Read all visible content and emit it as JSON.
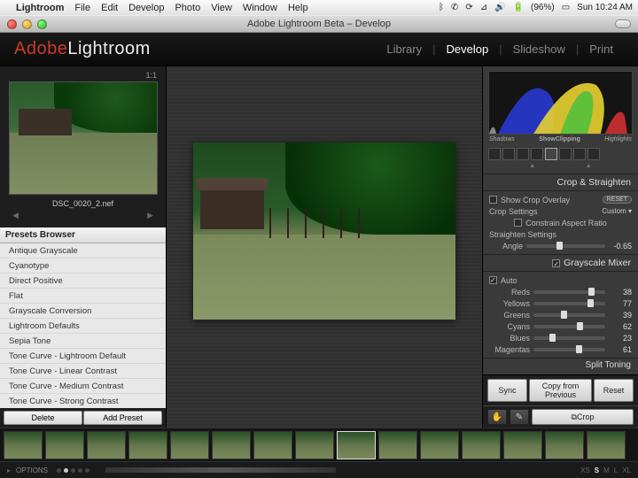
{
  "menubar": {
    "app": "Lightroom",
    "items": [
      "File",
      "Edit",
      "Develop",
      "Photo",
      "View",
      "Window",
      "Help"
    ],
    "battery": "(96%)",
    "clock": "Sun 10:24 AM"
  },
  "window_title": "Adobe Lightroom Beta – Develop",
  "logo": {
    "adobe": "Adobe",
    "product": "Lightroom"
  },
  "modules": {
    "items": [
      "Library",
      "Develop",
      "Slideshow",
      "Print"
    ],
    "active": "Develop"
  },
  "navigator": {
    "ratio": "1:1",
    "filename": "DSC_0020_2.nef"
  },
  "presets": {
    "header": "Presets Browser",
    "items": [
      "Antique Grayscale",
      "Cyanotype",
      "Direct Positive",
      "Flat",
      "Grayscale Conversion",
      "Lightroom Defaults",
      "Sepia Tone",
      "Tone Curve - Lightroom Default",
      "Tone Curve - Linear Contrast",
      "Tone Curve - Medium Contrast",
      "Tone Curve - Strong Contrast"
    ],
    "delete": "Delete",
    "add": "Add Preset"
  },
  "histogram": {
    "shadows": "Shadows",
    "mid": "ShowClipping",
    "highlights": "Highlights"
  },
  "crop": {
    "title": "Crop & Straighten",
    "show_overlay": "Show Crop Overlay",
    "reset": "RESET",
    "settings": "Crop Settings",
    "custom": "Custom",
    "constrain": "Constrain Aspect Ratio",
    "straighten": "Straighten Settings",
    "angle": "Angle",
    "angle_val": "-0.65"
  },
  "mixer": {
    "title": "Grayscale Mixer",
    "gray_chk": true,
    "auto": "Auto",
    "channels": [
      {
        "name": "Reds",
        "val": "38"
      },
      {
        "name": "Yellows",
        "val": "77"
      },
      {
        "name": "Greens",
        "val": "39"
      },
      {
        "name": "Cyans",
        "val": "62"
      },
      {
        "name": "Blues",
        "val": "23"
      },
      {
        "name": "Magentas",
        "val": "61"
      }
    ]
  },
  "split": "Split Toning",
  "buttons": {
    "sync": "Sync",
    "copy": "Copy from Previous",
    "reset": "Reset"
  },
  "tools": {
    "crop": "Crop"
  },
  "options": {
    "label": "OPTIONS",
    "sizes": [
      "XS",
      "S",
      "M",
      "L",
      "XL"
    ],
    "active_size": "S"
  }
}
